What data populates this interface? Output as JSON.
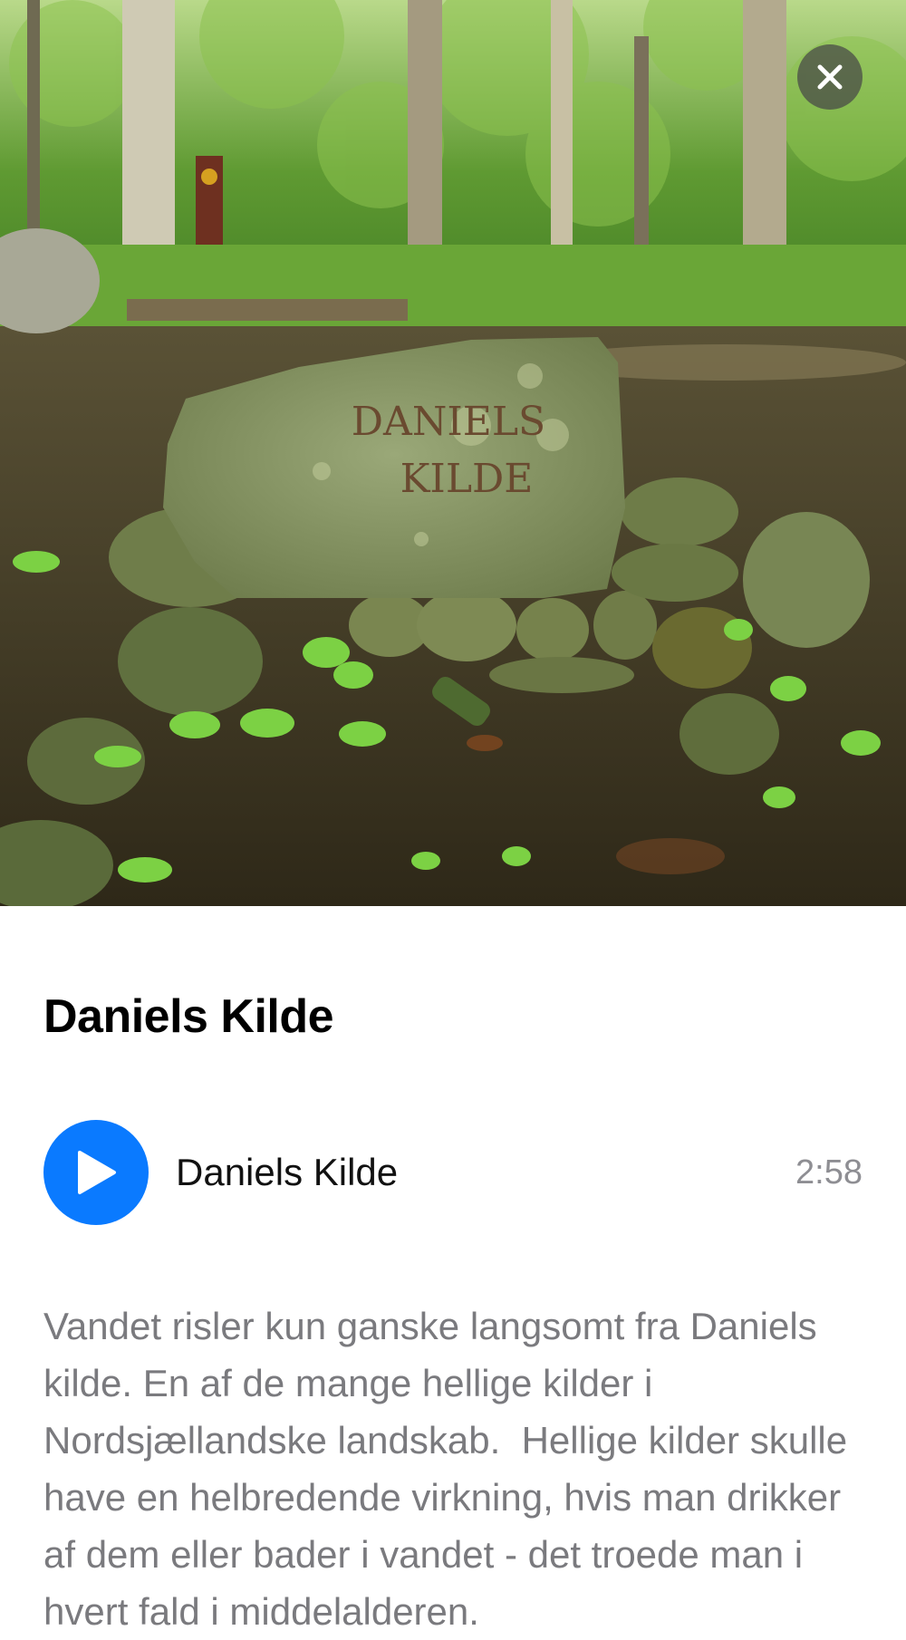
{
  "header": {
    "close_icon": "close-icon"
  },
  "place": {
    "title": "Daniels Kilde"
  },
  "audio": {
    "play_icon": "play-icon",
    "track_title": "Daniels Kilde",
    "duration": "2:58",
    "accent_color": "#0a7aff"
  },
  "description": {
    "text": "Vandet risler kun ganske langsomt fra Daniels kilde. En af de mange hellige kilder i Nordsjællandske landskab.  Hellige kilder skulle have en helbredende virkning, hvis man drikker af dem eller bader i vandet - det troede man i hvert fald i middelalderen."
  },
  "photo": {
    "stone_inscription_line1": "DANIELS",
    "stone_inscription_line2": "KILDE"
  }
}
